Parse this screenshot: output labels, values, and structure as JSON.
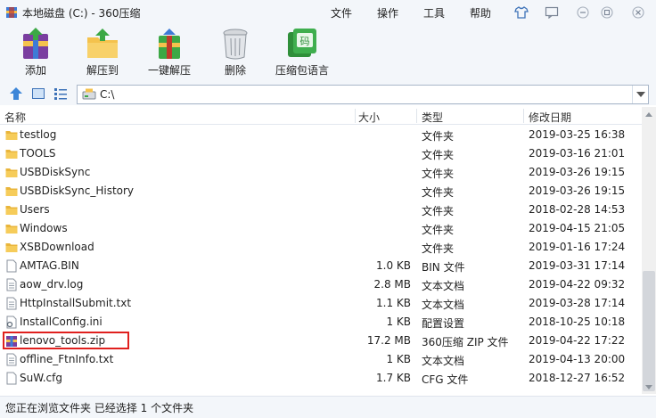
{
  "window": {
    "title": "本地磁盘 (C:) - 360压缩"
  },
  "menu": [
    "文件",
    "操作",
    "工具",
    "帮助"
  ],
  "toolbar": {
    "add": "添加",
    "extract_to": "解压到",
    "one_click_extract": "一键解压",
    "delete": "删除",
    "language": "压缩包语言"
  },
  "address": {
    "path": "C:\\"
  },
  "columns": {
    "name": "名称",
    "size": "大小",
    "type": "类型",
    "modified": "修改日期"
  },
  "files": [
    {
      "name": "testlog",
      "size": "",
      "type": "文件夹",
      "modified": "2019-03-25 16:38",
      "icon": "folder-icon"
    },
    {
      "name": "TOOLS",
      "size": "",
      "type": "文件夹",
      "modified": "2019-03-16 21:01",
      "icon": "folder-icon"
    },
    {
      "name": "USBDiskSync",
      "size": "",
      "type": "文件夹",
      "modified": "2019-03-26 19:15",
      "icon": "folder-icon"
    },
    {
      "name": "USBDiskSync_History",
      "size": "",
      "type": "文件夹",
      "modified": "2019-03-26 19:15",
      "icon": "folder-icon"
    },
    {
      "name": "Users",
      "size": "",
      "type": "文件夹",
      "modified": "2018-02-28 14:53",
      "icon": "folder-icon"
    },
    {
      "name": "Windows",
      "size": "",
      "type": "文件夹",
      "modified": "2019-04-15 21:05",
      "icon": "folder-icon"
    },
    {
      "name": "XSBDownload",
      "size": "",
      "type": "文件夹",
      "modified": "2019-01-16 17:24",
      "icon": "folder-icon"
    },
    {
      "name": "AMTAG.BIN",
      "size": "1.0 KB",
      "type": "BIN 文件",
      "modified": "2019-03-31 17:14",
      "icon": "file-icon"
    },
    {
      "name": "aow_drv.log",
      "size": "2.8 MB",
      "type": "文本文档",
      "modified": "2019-04-22 09:32",
      "icon": "text-file-icon"
    },
    {
      "name": "HttpInstallSubmit.txt",
      "size": "1.1 KB",
      "type": "文本文档",
      "modified": "2019-03-28 17:14",
      "icon": "text-file-icon"
    },
    {
      "name": "InstallConfig.ini",
      "size": "1 KB",
      "type": "配置设置",
      "modified": "2018-10-25 10:18",
      "icon": "config-file-icon"
    },
    {
      "name": "lenovo_tools.zip",
      "size": "17.2 MB",
      "type": "360压缩 ZIP 文件",
      "modified": "2019-04-22 17:22",
      "icon": "zip-file-icon"
    },
    {
      "name": "offline_FtnInfo.txt",
      "size": "1 KB",
      "type": "文本文档",
      "modified": "2019-04-13 20:00",
      "icon": "text-file-icon"
    },
    {
      "name": "SuW.cfg",
      "size": "1.7 KB",
      "type": "CFG 文件",
      "modified": "2018-12-27 16:52",
      "icon": "file-icon"
    }
  ],
  "status": {
    "text": "您正在浏览文件夹 已经选择 1 个文件夹"
  },
  "colors": {
    "chrome": "#f3f6fa",
    "highlight": "#e0201e",
    "folder": "#f4c24d"
  }
}
